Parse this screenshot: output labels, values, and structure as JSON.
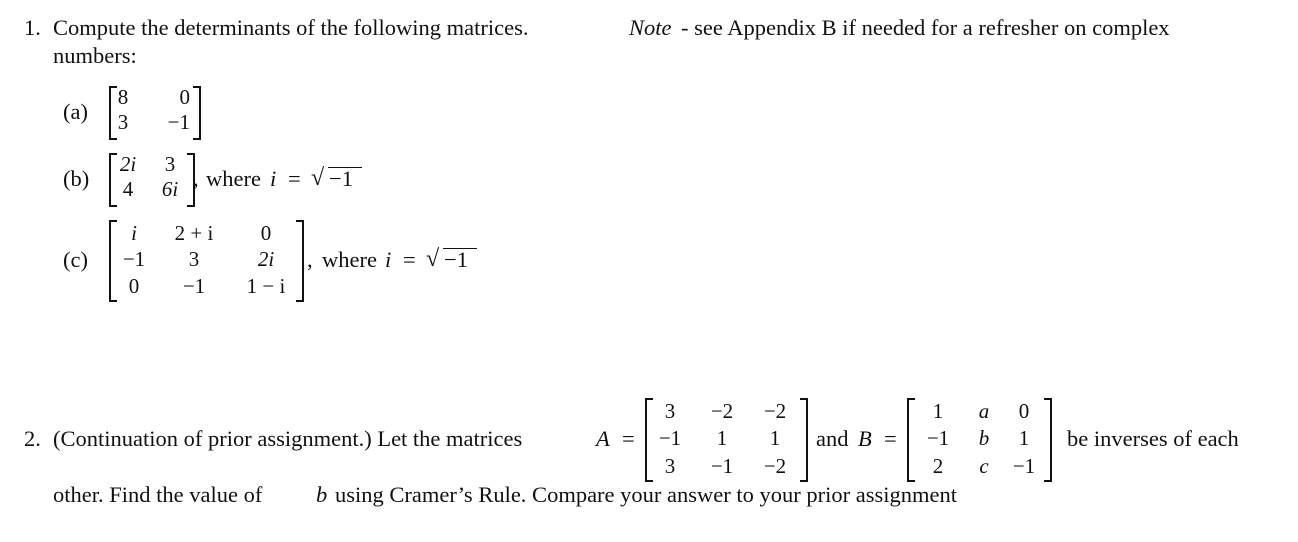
{
  "problem1": {
    "number": "1.",
    "intro_text": "Compute the determinants of the following matrices.",
    "note_label": "Note",
    "note_text": "- see Appendix B if needed for a refresher on complex",
    "line2": "numbers:",
    "parts": [
      {
        "label": "(a)",
        "matrix": [
          [
            "8",
            "0"
          ],
          [
            "3",
            "−1"
          ]
        ],
        "suffix": ""
      },
      {
        "label": "(b)",
        "matrix": [
          [
            "2i",
            "3"
          ],
          [
            "4",
            "6i"
          ]
        ],
        "suffix": ", where i = √−1"
      },
      {
        "label": "(c)",
        "matrix": [
          [
            "i",
            "2 + i",
            "0"
          ],
          [
            "−1",
            "3",
            "2i"
          ],
          [
            "0",
            "−1",
            "1 − i"
          ]
        ],
        "suffix": ", where i = √−1"
      }
    ],
    "where_text": "where",
    "i_var": "i",
    "equals": "=",
    "sqrt_symbol": "√",
    "radicand": "−1",
    "comma": ","
  },
  "problem2": {
    "number": "2.",
    "text_before_A": "(Continuation of prior assignment.) Let the matrices",
    "A_var": "A",
    "equals": "=",
    "matrix_A": [
      [
        "3",
        "−2",
        "−2"
      ],
      [
        "−1",
        "1",
        "1"
      ],
      [
        "3",
        "−1",
        "−2"
      ]
    ],
    "and_text": "and",
    "B_var": "B",
    "matrix_B": [
      [
        "1",
        "a",
        "0"
      ],
      [
        "−1",
        "b",
        "1"
      ],
      [
        "2",
        "c",
        "−1"
      ]
    ],
    "text_after_B": "be inverses of each",
    "line2_before_b": "other. Find the value of",
    "b_var": "b",
    "line2_after_b": "using Cramer’s Rule. Compare your answer to your prior assignment"
  }
}
